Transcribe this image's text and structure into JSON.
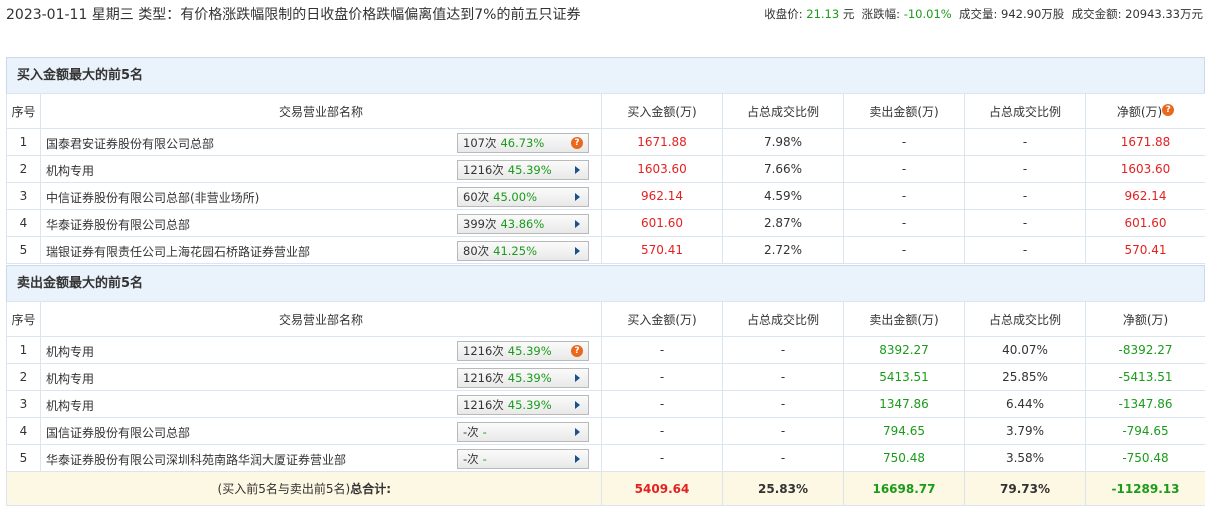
{
  "header": {
    "title": "2023-01-11 星期三 类型：有价格涨跌幅限制的日收盘价格跌幅偏离值达到7%的前五只证券",
    "close_label": "收盘价:",
    "close_value": "21.13",
    "close_unit": "元",
    "change_label": "涨跌幅:",
    "change_value": "-10.01%",
    "volume_label": "成交量:",
    "volume_value": "942.90万股",
    "turnover_label": "成交金额:",
    "turnover_value": "20943.33万元"
  },
  "columns": [
    "序号",
    "交易营业部名称",
    "买入金额(万)",
    "占总成交比例",
    "卖出金额(万)",
    "占总成交比例",
    "净额(万)"
  ],
  "buy_section": {
    "title": "买入金额最大的前5名",
    "rows": [
      {
        "no": "1",
        "name": "国泰君安证券股份有限公司总部",
        "count": "107次",
        "rate": "46.73%",
        "icon": "question-icon",
        "buy": "1671.88",
        "buy_pct": "7.98%",
        "sell": "-",
        "sell_pct": "-",
        "net": "1671.88"
      },
      {
        "no": "2",
        "name": "机构专用",
        "count": "1216次",
        "rate": "45.39%",
        "icon": "arrow-right-icon",
        "buy": "1603.60",
        "buy_pct": "7.66%",
        "sell": "-",
        "sell_pct": "-",
        "net": "1603.60"
      },
      {
        "no": "3",
        "name": "中信证券股份有限公司总部(非营业场所)",
        "count": "60次",
        "rate": "45.00%",
        "icon": "arrow-right-icon",
        "buy": "962.14",
        "buy_pct": "4.59%",
        "sell": "-",
        "sell_pct": "-",
        "net": "962.14"
      },
      {
        "no": "4",
        "name": "华泰证券股份有限公司总部",
        "count": "399次",
        "rate": "43.86%",
        "icon": "arrow-right-icon",
        "buy": "601.60",
        "buy_pct": "2.87%",
        "sell": "-",
        "sell_pct": "-",
        "net": "601.60"
      },
      {
        "no": "5",
        "name": "瑞银证券有限责任公司上海花园石桥路证券营业部",
        "count": "80次",
        "rate": "41.25%",
        "icon": "arrow-right-icon",
        "buy": "570.41",
        "buy_pct": "2.72%",
        "sell": "-",
        "sell_pct": "-",
        "net": "570.41"
      }
    ]
  },
  "sell_section": {
    "title": "卖出金额最大的前5名",
    "rows": [
      {
        "no": "1",
        "name": "机构专用",
        "count": "1216次",
        "rate": "45.39%",
        "icon": "question-icon",
        "buy": "-",
        "buy_pct": "-",
        "sell": "8392.27",
        "sell_pct": "40.07%",
        "net": "-8392.27"
      },
      {
        "no": "2",
        "name": "机构专用",
        "count": "1216次",
        "rate": "45.39%",
        "icon": "arrow-right-icon",
        "buy": "-",
        "buy_pct": "-",
        "sell": "5413.51",
        "sell_pct": "25.85%",
        "net": "-5413.51"
      },
      {
        "no": "3",
        "name": "机构专用",
        "count": "1216次",
        "rate": "45.39%",
        "icon": "arrow-right-icon",
        "buy": "-",
        "buy_pct": "-",
        "sell": "1347.86",
        "sell_pct": "6.44%",
        "net": "-1347.86"
      },
      {
        "no": "4",
        "name": "国信证券股份有限公司总部",
        "count": "-次",
        "rate": "-",
        "icon": "arrow-right-icon",
        "buy": "-",
        "buy_pct": "-",
        "sell": "794.65",
        "sell_pct": "3.79%",
        "net": "-794.65"
      },
      {
        "no": "5",
        "name": "华泰证券股份有限公司深圳科苑南路华润大厦证券营业部",
        "count": "-次",
        "rate": "-",
        "icon": "arrow-right-icon",
        "buy": "-",
        "buy_pct": "-",
        "sell": "750.48",
        "sell_pct": "3.58%",
        "net": "-750.48"
      }
    ]
  },
  "total": {
    "label_prefix": "(买入前5名与卖出前5名)",
    "label": "总合计:",
    "buy": "5409.64",
    "buy_pct": "25.83%",
    "sell": "16698.77",
    "sell_pct": "79.73%",
    "net": "-11289.13"
  },
  "colors": {
    "up": "#e42121",
    "down": "#1a9b1a",
    "section_bg": "#eaf2fb",
    "total_bg": "#fdf8e3"
  }
}
